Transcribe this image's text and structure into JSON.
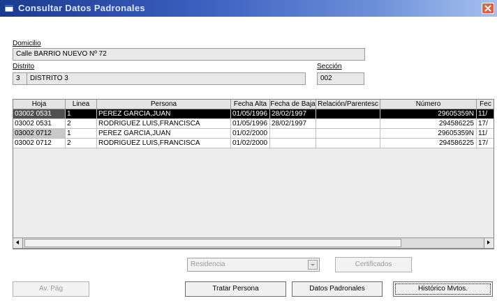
{
  "window": {
    "title": "Consultar Datos Padronales"
  },
  "form": {
    "domicilio_label": "Domicilio",
    "domicilio_value": "Calle BARRIO NUEVO Nº 72",
    "distrito_label": "Distrito",
    "distrito_code": "3",
    "distrito_name": "DISTRITO 3",
    "seccion_label": "Sección",
    "seccion_value": "002"
  },
  "table": {
    "columns": [
      "Hoja",
      "Linea",
      "Persona",
      "Fecha Alta",
      "Fecha de Baja",
      "Relación/Parentesc",
      "Número",
      "Fec"
    ],
    "rows": [
      [
        "03002 0531",
        "1",
        "PEREZ GARCIA,JUAN",
        "01/05/1996",
        "28/02/1997",
        "",
        "29605359N",
        "11/"
      ],
      [
        "03002 0531",
        "2",
        "RODRIGUEZ LUIS,FRANCISCA",
        "01/05/1996",
        "28/02/1997",
        "",
        "294586225",
        "17/"
      ],
      [
        "03002 0712",
        "1",
        "PEREZ GARCIA,JUAN",
        "01/02/2000",
        "",
        "",
        "29605359N",
        "11/"
      ],
      [
        "03002 0712",
        "2",
        "RODRIGUEZ LUIS,FRANCISCA",
        "01/02/2000",
        "",
        "",
        "294586225",
        "17/"
      ]
    ],
    "selected_row": 0
  },
  "controls": {
    "residencia_value": "Residencia",
    "certificados_label": "Certificados",
    "av_pag_label": "Av. Pág",
    "tratar_persona_label": "Tratar Persona",
    "datos_padronales_label": "Datos Padronales",
    "historico_label": "Histórico Mvtos."
  },
  "colors": {
    "titlebar_start": "#1b3b8f",
    "titlebar_end": "#a7c0ee",
    "selected_row_bg": "#000000",
    "field_bg": "#e8e8e8"
  }
}
